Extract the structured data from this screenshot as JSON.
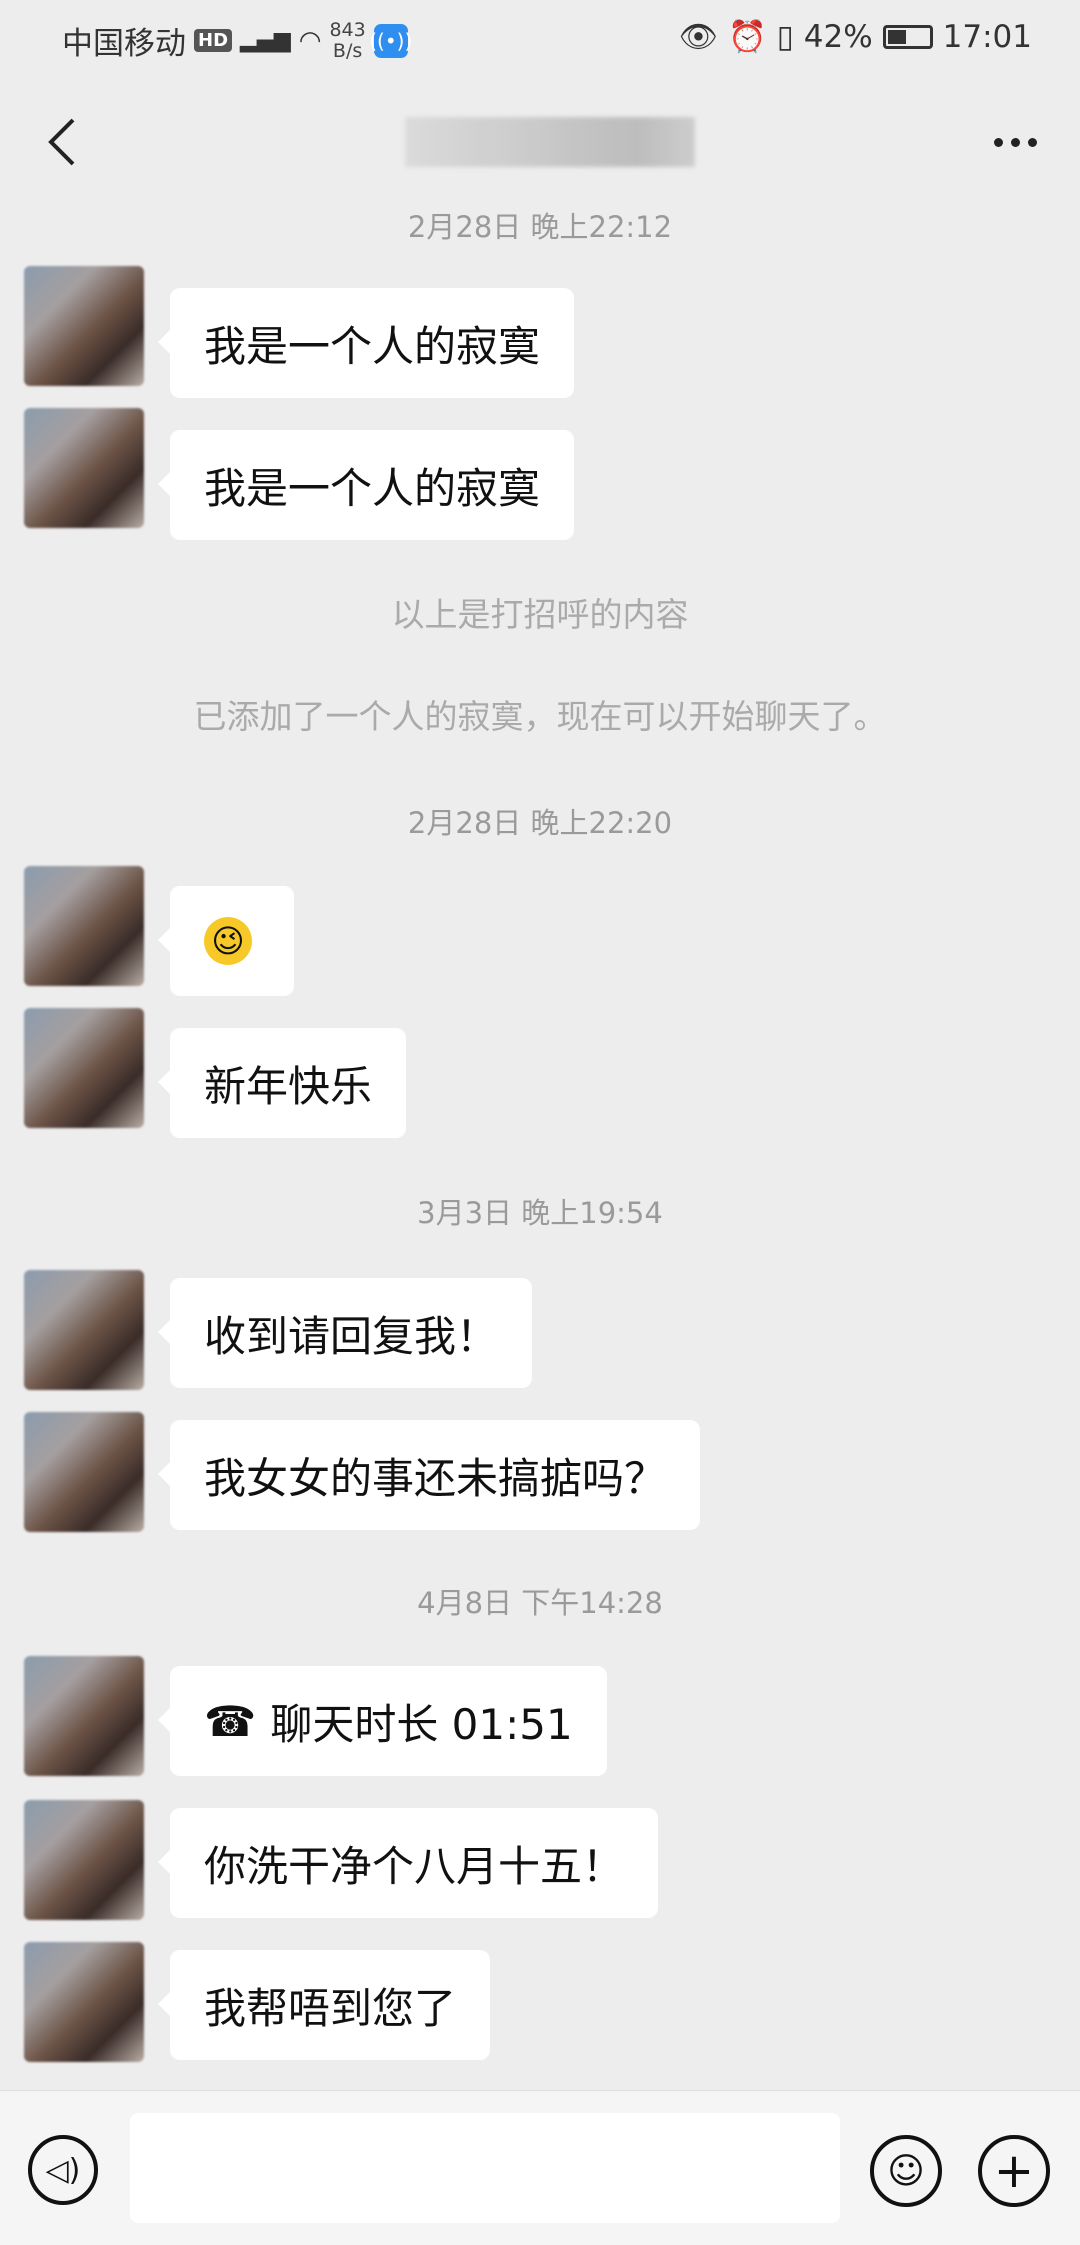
{
  "status_bar": {
    "carrier": "中国移动",
    "hd": "HD",
    "net_speed_value": "843",
    "net_speed_unit": "B/s",
    "battery": "42%",
    "time": "17:01"
  },
  "chat": {
    "items": [
      {
        "type": "timestamp",
        "text": "2月28日 晚上22:12"
      },
      {
        "type": "message",
        "text": "我是一个人的寂寞"
      },
      {
        "type": "message",
        "text": "我是一个人的寂寞"
      },
      {
        "type": "system",
        "text": "以上是打招呼的内容"
      },
      {
        "type": "system",
        "text": "已添加了一个人的寂寞，现在可以开始聊天了。"
      },
      {
        "type": "timestamp",
        "text": "2月28日 晚上22:20"
      },
      {
        "type": "message",
        "text": ""
      },
      {
        "type": "message",
        "text": "新年快乐"
      },
      {
        "type": "timestamp",
        "text": "3月3日 晚上19:54"
      },
      {
        "type": "message",
        "text": "收到请回复我！"
      },
      {
        "type": "message",
        "text": "我女女的事还未搞掂吗？"
      },
      {
        "type": "timestamp",
        "text": "4月8日 下午14:28"
      },
      {
        "type": "message",
        "text": "聊天时长 01:51"
      },
      {
        "type": "message",
        "text": "你洗干净个八月十五！"
      },
      {
        "type": "message",
        "text": "我帮唔到您了"
      }
    ]
  },
  "icons": {
    "back": "chevron-left-icon",
    "more": "more-icon",
    "voice": "voice-icon",
    "emoji": "emoji-icon",
    "plus": "plus-icon"
  }
}
